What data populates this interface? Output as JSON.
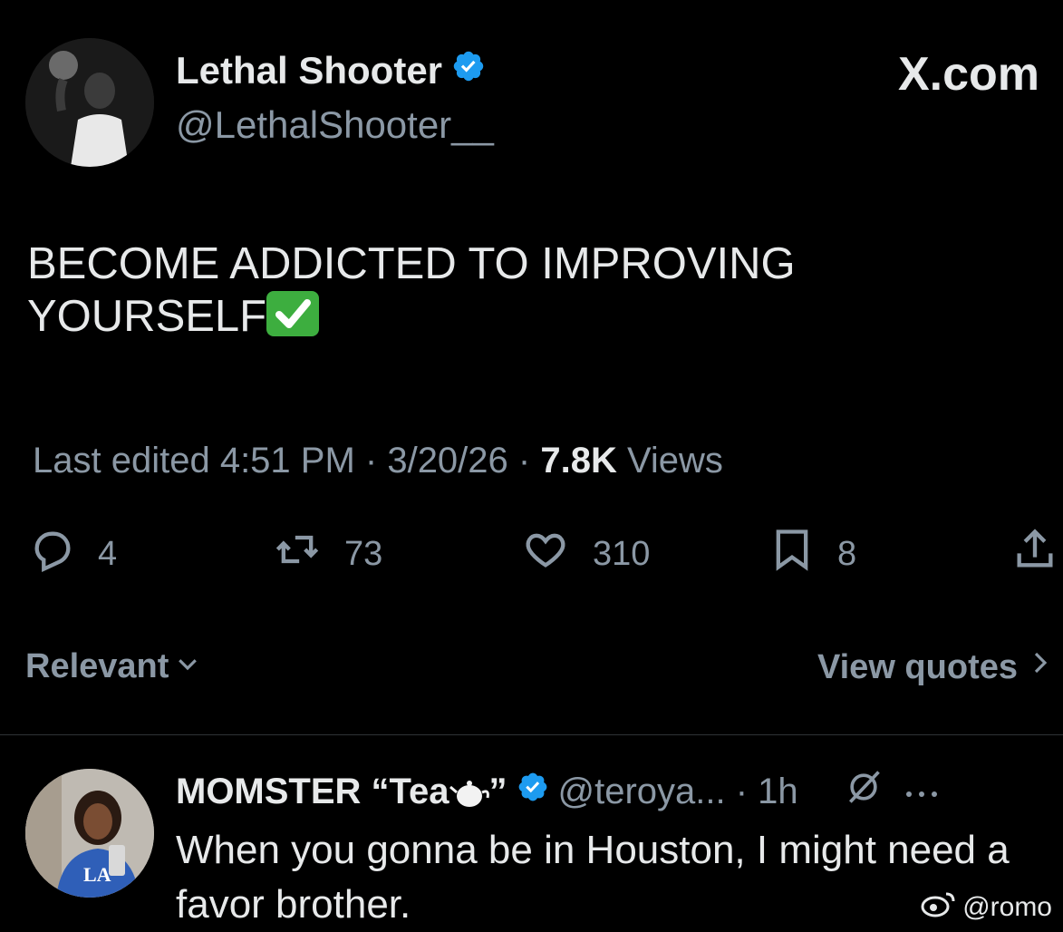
{
  "author": {
    "name": "Lethal Shooter",
    "handle": "@LethalShooter__"
  },
  "brand": "X.com",
  "tweet": {
    "text_line1": "BECOME ADDICTED TO IMPROVING",
    "text_line2": "YOURSELF"
  },
  "meta": {
    "edited_prefix": "Last edited 4:51 PM · 3/20/26",
    "separator": " · ",
    "views_count": "7.8K",
    "views_label": " Views"
  },
  "actions": {
    "replies": "4",
    "reposts": "73",
    "likes": "310",
    "bookmarks": "8"
  },
  "sort": {
    "relevant_label": "Relevant",
    "view_quotes_label": "View quotes"
  },
  "reply": {
    "name": "MOMSTER “Tea",
    "name_suffix": "”",
    "handle_time": "@teroya... · 1h",
    "text": "When you gonna be in Houston, I might need a favor brother."
  },
  "watermark": "@romo",
  "colors": {
    "verified": "#1d9bf0",
    "background": "#000000",
    "secondary_text": "#8b98a5"
  }
}
